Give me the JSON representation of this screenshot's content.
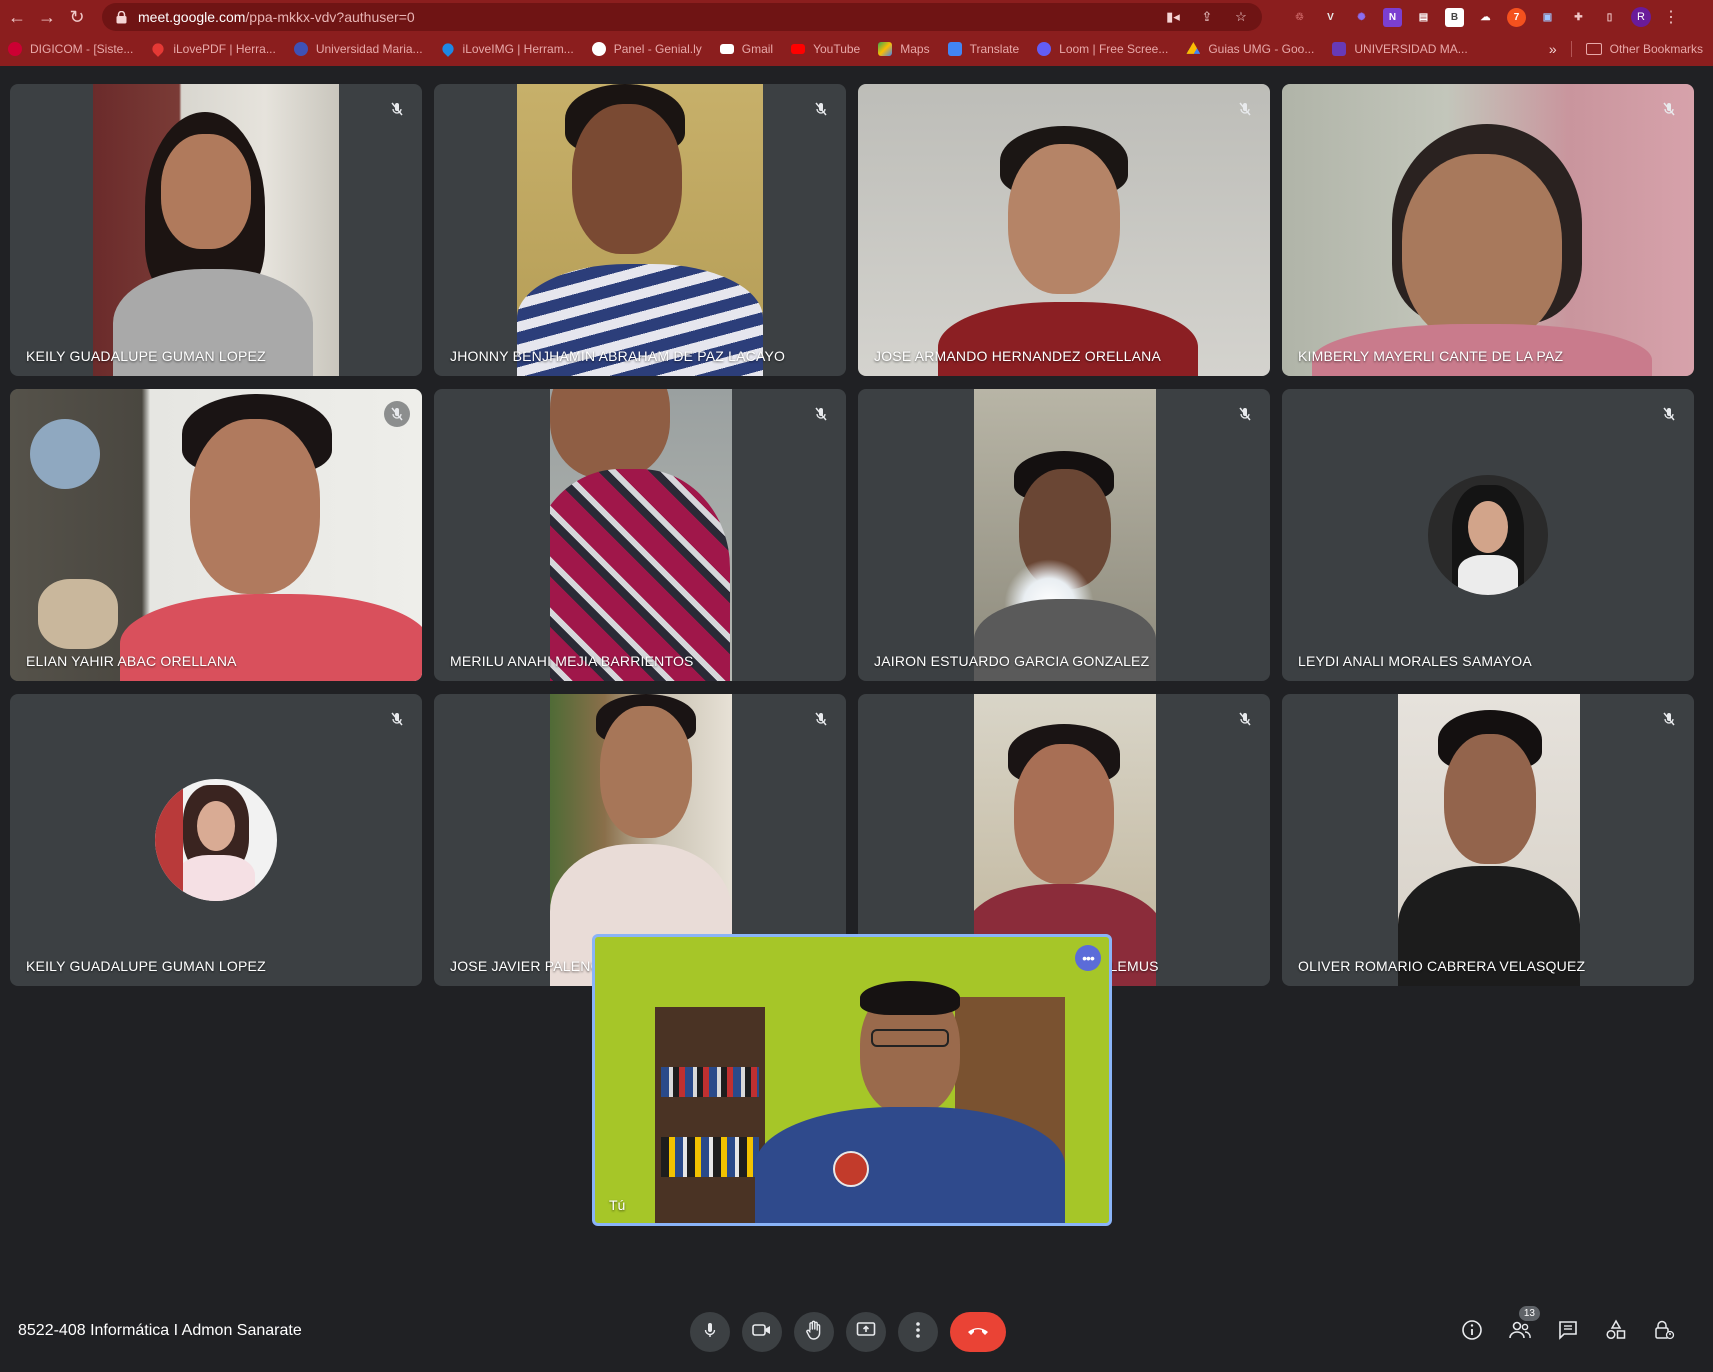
{
  "browser": {
    "url_host": "meet.google.com",
    "url_path": "/ppa-mkkx-vdv?authuser=0",
    "profile_initial": "R",
    "bookmarks": [
      {
        "label": "DIGICOM - [Siste...",
        "color": "#d33"
      },
      {
        "label": "iLovePDF | Herra...",
        "color": "#e53935"
      },
      {
        "label": "Universidad Maria...",
        "color": "#3f51b5"
      },
      {
        "label": "iLoveIMG | Herram...",
        "color": "#1e88e5"
      },
      {
        "label": "Panel - Genial.ly",
        "color": "#ffffff"
      },
      {
        "label": "Gmail",
        "color": "#ffffff"
      },
      {
        "label": "YouTube",
        "color": "#ff0000"
      },
      {
        "label": "Maps",
        "color": "#34a853"
      },
      {
        "label": "Translate",
        "color": "#4285f4"
      },
      {
        "label": "Loom | Free Scree...",
        "color": "#625df5"
      },
      {
        "label": "Guias UMG - Goo...",
        "color": "#fbbc04"
      },
      {
        "label": "UNIVERSIDAD MA...",
        "color": "#673ab7"
      }
    ],
    "bookmarks_more": "»",
    "other_bookmarks": "Other Bookmarks"
  },
  "participants": [
    {
      "name": "KEILY GUADALUPE GUMAN LOPEZ",
      "type": "video"
    },
    {
      "name": "JHONNY BENJHAMIN ABRAHAM DE PAZ LACAYO",
      "type": "video"
    },
    {
      "name": "JOSE ARMANDO HERNANDEZ ORELLANA",
      "type": "video"
    },
    {
      "name": "KIMBERLY MAYERLI CANTE DE LA PAZ",
      "type": "video"
    },
    {
      "name": "ELIAN YAHIR ABAC ORELLANA",
      "type": "video"
    },
    {
      "name": "MERILU ANAHI MEJIA BARRIENTOS",
      "type": "video"
    },
    {
      "name": "JAIRON ESTUARDO GARCIA GONZALEZ",
      "type": "video"
    },
    {
      "name": "LEYDI ANALI MORALES SAMAYOA",
      "type": "avatar"
    },
    {
      "name": "KEILY GUADALUPE GUMAN LOPEZ",
      "type": "avatar"
    },
    {
      "name": "JOSE JAVIER PALENCIA GOMEZ",
      "type": "video"
    },
    {
      "name": "WILBER ESTUARDO MARROQUIN LEMUS",
      "type": "video"
    },
    {
      "name": "OLIVER ROMARIO CABRERA VELASQUEZ",
      "type": "video"
    }
  ],
  "self_view": {
    "label": "Tú"
  },
  "meeting": {
    "title": "8522-408 Informática I Admon Sanarate",
    "participant_count": "13"
  },
  "colors": {
    "chrome": "#8b1e1e",
    "stage": "#202124",
    "tile": "#3c4043",
    "end_call": "#ea4335",
    "self_border": "#8ab4f8"
  }
}
